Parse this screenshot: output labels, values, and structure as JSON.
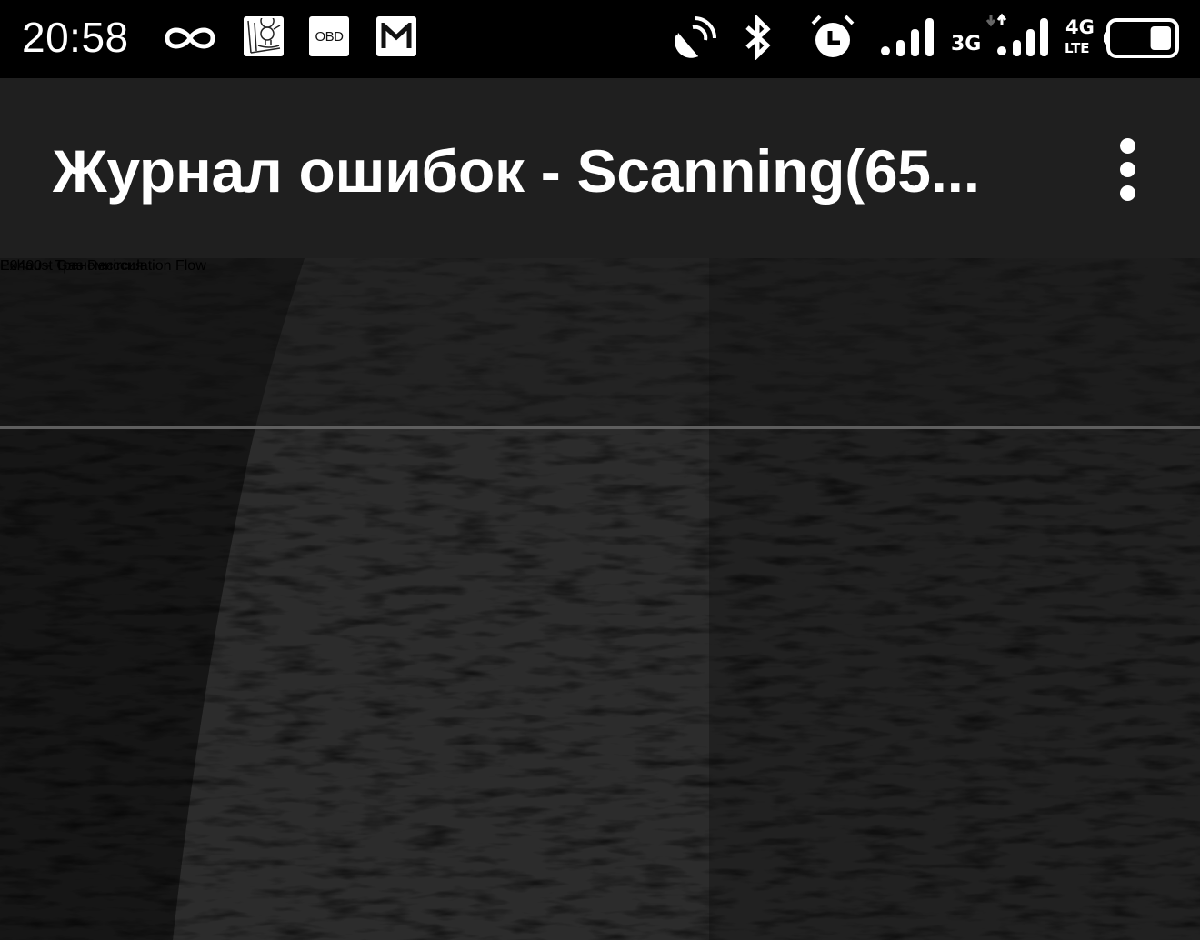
{
  "status_bar": {
    "time": "20:58",
    "notification_icons": [
      "infinity-icon",
      "map-app-icon",
      "obd-app-icon",
      "gmail-icon"
    ],
    "obd_label": "OBD",
    "system_icons": [
      "satellite-dish-icon",
      "bluetooth-icon",
      "alarm-clock-icon",
      "signal-strength-icon",
      "signal-strength-icon",
      "battery-icon"
    ],
    "network_sim1": "3G",
    "network_sim2_top": "4G",
    "network_sim2_bottom": "LTE",
    "battery_level_percent": 35
  },
  "toolbar": {
    "title": "Журнал ошибок - Scanning(65...",
    "overflow_menu_icon": "more-vert-icon"
  },
  "error_list": [
    {
      "code_line": "P0400 - Трансмиссия",
      "description": "Exhaust Gas Recirculation Flow"
    }
  ],
  "colors": {
    "status_bar_bg": "#000000",
    "toolbar_bg": "#1f1f1f",
    "title_text": "#ffffff",
    "list_text": "#c8c8c8",
    "divider": "#5e5e5e"
  }
}
